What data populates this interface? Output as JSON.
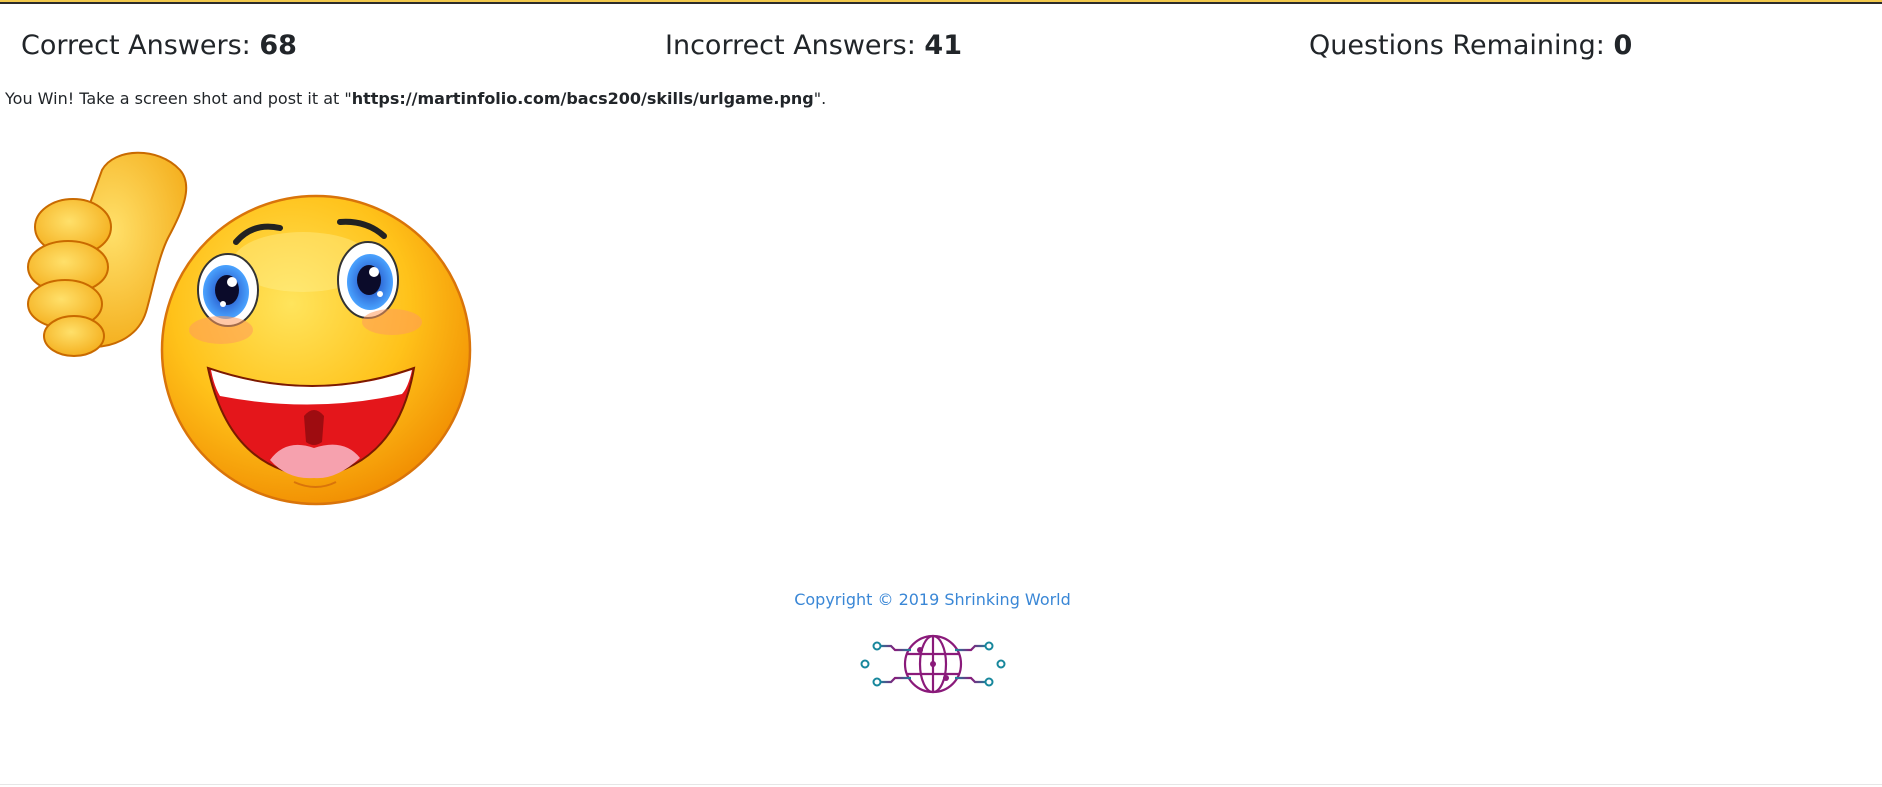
{
  "scoreboard": {
    "correct_label": "Correct Answers:",
    "correct_value": "68",
    "incorrect_label": "Incorrect Answers:",
    "incorrect_value": "41",
    "remaining_label": "Questions Remaining:",
    "remaining_value": "0"
  },
  "message": {
    "prefix": "You Win! Take a screen shot and post it at \"",
    "url": "https://martinfolio.com/bacs200/skills/urlgame.png",
    "suffix": "\"."
  },
  "footer": {
    "copyright": "Copyright © 2019 Shrinking World"
  },
  "colors": {
    "accent_bar": "#f2c94c",
    "link": "#3a87d6",
    "text": "#212529"
  },
  "icons": {
    "celebration": "thumbs-up-smiley-icon",
    "logo": "globe-circuit-logo-icon"
  }
}
